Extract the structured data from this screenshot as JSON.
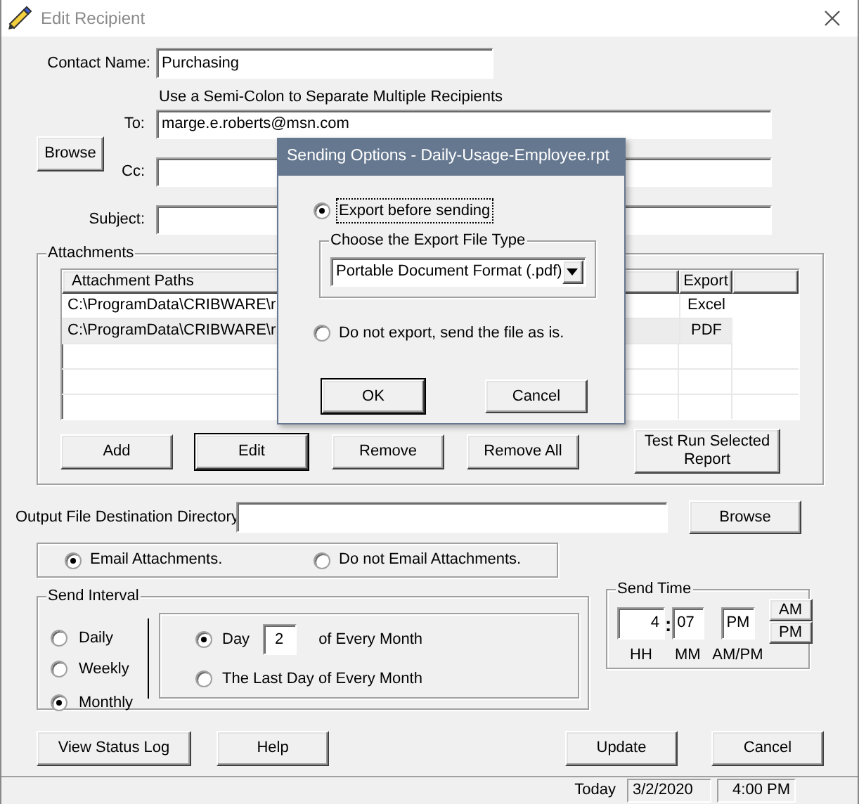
{
  "window": {
    "title": "Edit Recipient"
  },
  "contact_name": {
    "label": "Contact Name:",
    "value": "Purchasing"
  },
  "recipients_hint": "Use a Semi-Colon to Separate Multiple Recipients",
  "to": {
    "label": "To:",
    "value": "marge.e.roberts@msn.com"
  },
  "browse_button": "Browse",
  "cc": {
    "label": "Cc:"
  },
  "subject": {
    "label": "Subject:"
  },
  "attachments": {
    "title": "Attachments",
    "columns": [
      "Attachment Paths",
      "Export"
    ],
    "rows": [
      {
        "path": "C:\\ProgramData\\CRIBWARE\\r",
        "export": "Excel",
        "selected": false
      },
      {
        "path": "C:\\ProgramData\\CRIBWARE\\r",
        "export": "PDF",
        "selected": true
      }
    ],
    "buttons": [
      {
        "label": "Add",
        "default": false
      },
      {
        "label": "Edit",
        "default": true
      },
      {
        "label": "Remove",
        "default": false
      },
      {
        "label": "Remove All",
        "default": false
      },
      {
        "label": "Test Run Selected Report",
        "default": false
      }
    ]
  },
  "output_directory": {
    "label": "Output File Destination Directory",
    "browse_button": "Browse"
  },
  "email_options": [
    {
      "label": "Email Attachments.",
      "selected": true
    },
    {
      "label": "Do not Email Attachments.",
      "selected": false
    }
  ],
  "send_interval": {
    "title": "Send Interval",
    "options": [
      {
        "label": "Daily",
        "selected": false
      },
      {
        "label": "Weekly",
        "selected": false
      },
      {
        "label": "Monthly",
        "selected": true
      }
    ],
    "monthly_options": [
      {
        "kind": "day",
        "label": "Day",
        "value": "2",
        "suffix": "of Every Month",
        "selected": true
      },
      {
        "kind": "plain",
        "label": "The Last Day of Every Month",
        "selected": false
      }
    ]
  },
  "send_time": {
    "title": "Send Time",
    "hour": "4",
    "separator": ":",
    "minute": "07",
    "ampm": "PM",
    "hour_label": "HH",
    "minute_label": "MM",
    "ampm_label": "AM/PM",
    "buttons": [
      "AM",
      "PM"
    ]
  },
  "footer_buttons": [
    {
      "label": "View Status Log",
      "default": false
    },
    {
      "label": "Help",
      "default": false
    },
    {
      "label": "Update",
      "default": false
    },
    {
      "label": "Cancel",
      "default": false
    }
  ],
  "status_bar": {
    "label": "Today",
    "date": "3/2/2020",
    "time": "4:00 PM"
  },
  "dialog": {
    "title": "Sending Options - Daily-Usage-Employee.rpt",
    "options": [
      {
        "label": "Export before sending",
        "selected": true
      },
      {
        "label": "Do not export, send the file as is.",
        "selected": false
      }
    ],
    "file_type": {
      "title": "Choose the Export File Type",
      "value": "Portable Document Format (.pdf)"
    },
    "buttons": [
      {
        "label": "OK",
        "default": true
      },
      {
        "label": "Cancel",
        "default": false
      }
    ]
  }
}
